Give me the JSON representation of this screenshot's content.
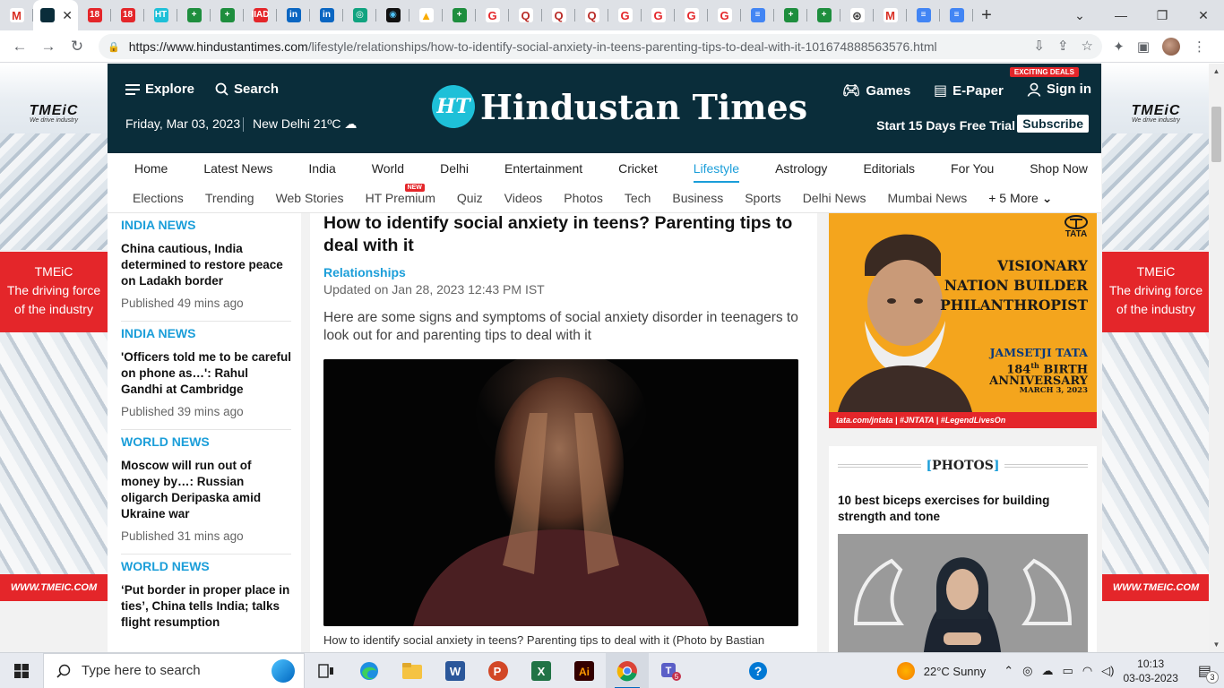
{
  "browser": {
    "tabs": [
      {
        "icon": "gmail-icon",
        "glyph": "M",
        "bg": "#ffffff",
        "fg": "#d93025"
      },
      {
        "icon": "hindustan-times-icon",
        "glyph": "",
        "bg": "#0a2d3a",
        "fg": "#ffffff",
        "active": true
      },
      {
        "icon": "news18-icon",
        "glyph": "18",
        "bg": "#e4262a",
        "fg": "#ffffff"
      },
      {
        "icon": "news18-icon",
        "glyph": "18",
        "bg": "#e4262a",
        "fg": "#ffffff"
      },
      {
        "icon": "ht-icon",
        "glyph": "HT",
        "bg": "#1ec0d8",
        "fg": "#ffffff"
      },
      {
        "icon": "sheets-plus-icon",
        "glyph": "+",
        "bg": "#1e8e3e",
        "fg": "#ffffff"
      },
      {
        "icon": "sheets-plus-icon",
        "glyph": "+",
        "bg": "#1e8e3e",
        "fg": "#ffffff"
      },
      {
        "icon": "iiad-icon",
        "glyph": "IIAD",
        "bg": "#e4262a",
        "fg": "#ffffff"
      },
      {
        "icon": "linkedin-icon",
        "glyph": "in",
        "bg": "#0a66c2",
        "fg": "#ffffff"
      },
      {
        "icon": "linkedin-icon",
        "glyph": "in",
        "bg": "#0a66c2",
        "fg": "#ffffff"
      },
      {
        "icon": "chatgpt-icon",
        "glyph": "◎",
        "bg": "#10a37f",
        "fg": "#ffffff"
      },
      {
        "icon": "photo-app-icon",
        "glyph": "◉",
        "bg": "#111111",
        "fg": "#4fc3f7"
      },
      {
        "icon": "google-drive-icon",
        "glyph": "▲",
        "bg": "#ffffff",
        "fg": "#f9ab00"
      },
      {
        "icon": "sheets-plus-icon",
        "glyph": "+",
        "bg": "#1e8e3e",
        "fg": "#ffffff"
      },
      {
        "icon": "grammarly-icon",
        "glyph": "G",
        "bg": "#ffffff",
        "fg": "#e4262a"
      },
      {
        "icon": "quora-icon",
        "glyph": "Q",
        "bg": "#ffffff",
        "fg": "#b92b27"
      },
      {
        "icon": "quora-icon",
        "glyph": "Q",
        "bg": "#ffffff",
        "fg": "#b92b27"
      },
      {
        "icon": "quora-icon",
        "glyph": "Q",
        "bg": "#ffffff",
        "fg": "#b92b27"
      },
      {
        "icon": "grammarly-icon",
        "glyph": "G",
        "bg": "#ffffff",
        "fg": "#e4262a"
      },
      {
        "icon": "grammarly-icon",
        "glyph": "G",
        "bg": "#ffffff",
        "fg": "#e4262a"
      },
      {
        "icon": "grammarly-icon",
        "glyph": "G",
        "bg": "#ffffff",
        "fg": "#e4262a"
      },
      {
        "icon": "grammarly-icon",
        "glyph": "G",
        "bg": "#ffffff",
        "fg": "#e4262a"
      },
      {
        "icon": "google-docs-icon",
        "glyph": "≡",
        "bg": "#4285f4",
        "fg": "#ffffff"
      },
      {
        "icon": "sheets-plus-icon",
        "glyph": "+",
        "bg": "#1e8e3e",
        "fg": "#ffffff"
      },
      {
        "icon": "sheets-plus-icon",
        "glyph": "+",
        "bg": "#1e8e3e",
        "fg": "#ffffff"
      },
      {
        "icon": "openai-icon",
        "glyph": "⊛",
        "bg": "#ffffff",
        "fg": "#333333"
      },
      {
        "icon": "gmail-icon",
        "glyph": "M",
        "bg": "#ffffff",
        "fg": "#d93025"
      },
      {
        "icon": "google-docs-icon",
        "glyph": "≡",
        "bg": "#4285f4",
        "fg": "#ffffff"
      },
      {
        "icon": "google-docs-icon",
        "glyph": "≡",
        "bg": "#4285f4",
        "fg": "#ffffff"
      }
    ],
    "url_host": "https://www.hindustantimes.com",
    "url_path": "/lifestyle/relationships/how-to-identify-social-anxiety-in-teens-parenting-tips-to-deal-with-it-101674888563576.html"
  },
  "header": {
    "explore": "Explore",
    "search": "Search",
    "date": "Friday, Mar 03, 2023",
    "city": "New Delhi 21",
    "temp_unit": "ºC",
    "logo_badge": "HT",
    "logo_name": "Hindustan Times",
    "games": "Games",
    "epaper": "E-Paper",
    "signin": "Sign in",
    "deals": "EXCITING DEALS",
    "trial": "Start 15 Days Free Trial",
    "subscribe": "Subscribe"
  },
  "nav_primary": [
    "Home",
    "Latest News",
    "India",
    "World",
    "Delhi",
    "Entertainment",
    "Cricket",
    "Lifestyle",
    "Astrology",
    "Editorials",
    "For You",
    "Shop Now"
  ],
  "nav_primary_active": "Lifestyle",
  "nav_secondary": [
    "Elections",
    "Trending",
    "Web Stories",
    "HT Premium",
    "Quiz",
    "Videos",
    "Photos",
    "Tech",
    "Business",
    "Sports",
    "Delhi News",
    "Mumbai News"
  ],
  "nav_new_badge": "NEW",
  "nav_more": "+ 5 More",
  "side_ad": {
    "logo": "TMEiC",
    "tagline": "We drive industry",
    "slogan_1": "TMEiC",
    "slogan_2": "The driving force",
    "slogan_3": "of the industry",
    "url": "WWW.TMEIC.COM"
  },
  "left_news": [
    {
      "category": "INDIA NEWS",
      "title": "China cautious, India determined to restore peace on Ladakh border",
      "time": "Published 49 mins ago"
    },
    {
      "category": "INDIA NEWS",
      "title": "'Officers told me to be careful on phone as…': Rahul Gandhi at Cambridge",
      "time": "Published 39 mins ago"
    },
    {
      "category": "WORLD NEWS",
      "title": "Moscow will run out of money by…: Russian oligarch Deripaska amid Ukraine war",
      "time": "Published 31 mins ago"
    },
    {
      "category": "WORLD NEWS",
      "title": "‘Put border in proper place in ties’, China tells India; talks flight resumption",
      "time": ""
    }
  ],
  "article": {
    "title": "How to identify social anxiety in teens? Parenting tips to deal with it",
    "section": "Relationships",
    "updated": "Updated on Jan 28, 2023 12:43 PM IST",
    "summary": "Here are some signs and symptoms of social anxiety disorder in teenagers to look out for and parenting tips to deal with it",
    "caption": "How to identify social anxiety in teens? Parenting tips to deal with it (Photo by Bastian"
  },
  "tata_ad": {
    "brand": "TATA",
    "line1": "VISIONARY",
    "line2": "NATION BUILDER",
    "line3": "PHILANTHROPIST",
    "name": "JAMSETJI TATA",
    "birth_number": "184",
    "birth_suffix": "th",
    "birth_word": " BIRTH",
    "anniversary": "ANNIVERSARY",
    "date": "MARCH 3, 2023",
    "footer": "tata.com/jntata | #JNTATA | #LegendLivesOn"
  },
  "photos": {
    "label": "PHOTOS",
    "open": "[",
    "close": "]",
    "title": "10 best biceps exercises for building strength and tone"
  },
  "taskbar": {
    "search_placeholder": "Type here to search",
    "weather": "22°C  Sunny",
    "time": "10:13",
    "date": "03-03-2023",
    "teams_badge": "5",
    "notif_count": "3"
  },
  "colors": {
    "ht_navy": "#0a2d3a",
    "accent": "#1b9ed9",
    "ad_red": "#e4262a",
    "tata_orange": "#f4a51d"
  }
}
